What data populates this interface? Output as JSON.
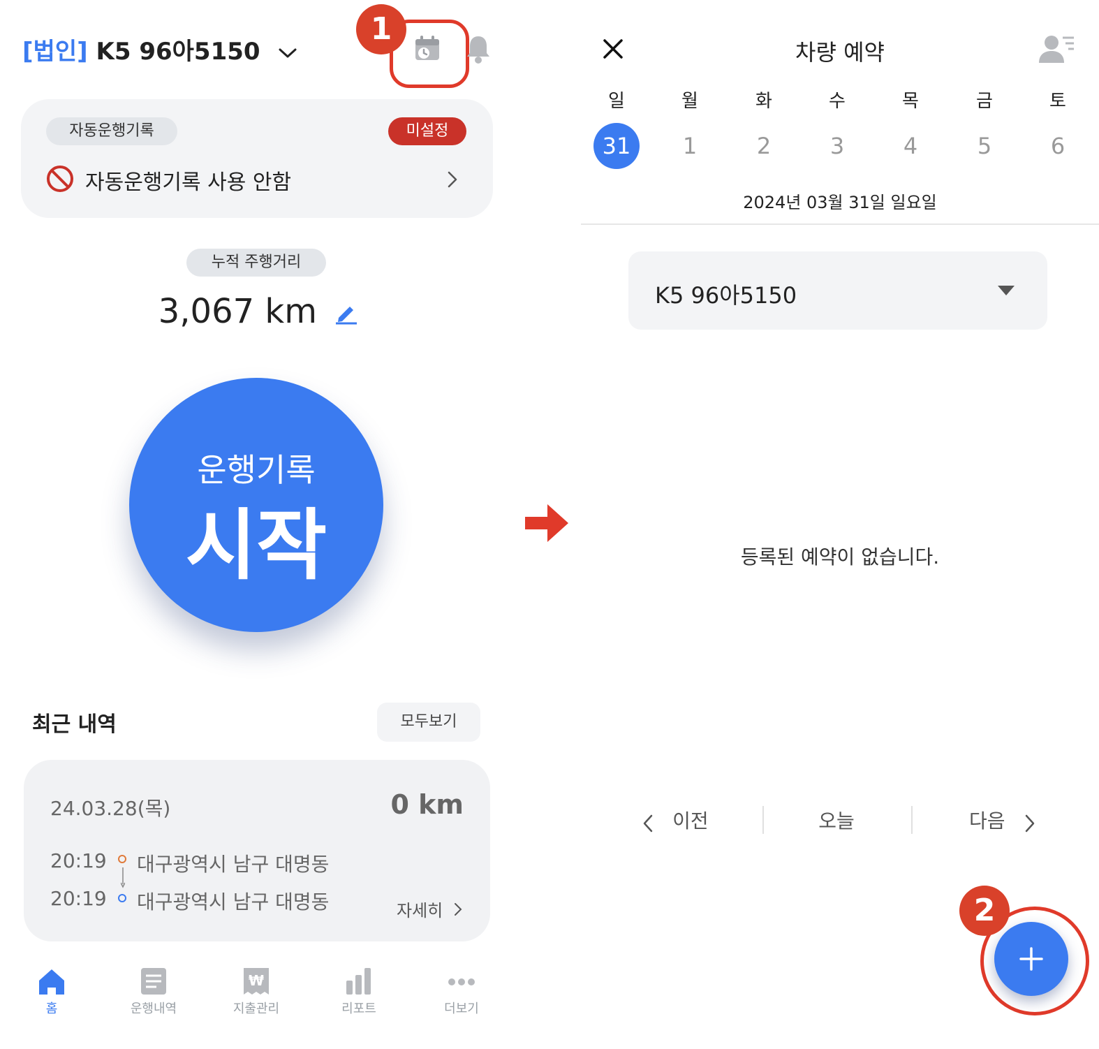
{
  "colors": {
    "accent": "#3b7bf0",
    "marker_red": "#d9412a",
    "badge_red": "#c93229",
    "card_bg": "#f3f4f6"
  },
  "left": {
    "header": {
      "prefix": "[법인]",
      "vehicle": "K5 96아5150",
      "marker": "1"
    },
    "auto_log": {
      "tag": "자동운행기록",
      "status": "미설정",
      "message": "자동운행기록 사용 안함"
    },
    "odometer": {
      "label": "누적 주행거리",
      "value": "3,067 km"
    },
    "start_button": {
      "sub": "운행기록",
      "main": "시작"
    },
    "recent": {
      "title": "최근 내역",
      "view_all": "모두보기",
      "item": {
        "date": "24.03.28(목)",
        "distance": "0 km",
        "from_time": "20:19",
        "from_place": "대구광역시 남구 대명동",
        "to_time": "20:19",
        "to_place": "대구광역시 남구 대명동",
        "detail": "자세히"
      }
    },
    "tabs": [
      {
        "label": "홈"
      },
      {
        "label": "운행내역"
      },
      {
        "label": "지출관리"
      },
      {
        "label": "리포트"
      },
      {
        "label": "더보기"
      }
    ]
  },
  "right": {
    "title": "차량 예약",
    "weekdays": [
      "일",
      "월",
      "화",
      "수",
      "목",
      "금",
      "토"
    ],
    "days": [
      "31",
      "1",
      "2",
      "3",
      "4",
      "5",
      "6"
    ],
    "selected_index": 0,
    "date_label": "2024년 03월 31일 일요일",
    "vehicle_select": "K5 96아5150",
    "empty_message": "등록된 예약이 없습니다.",
    "nav": {
      "prev": "이전",
      "today": "오늘",
      "next": "다음"
    },
    "marker": "2"
  }
}
